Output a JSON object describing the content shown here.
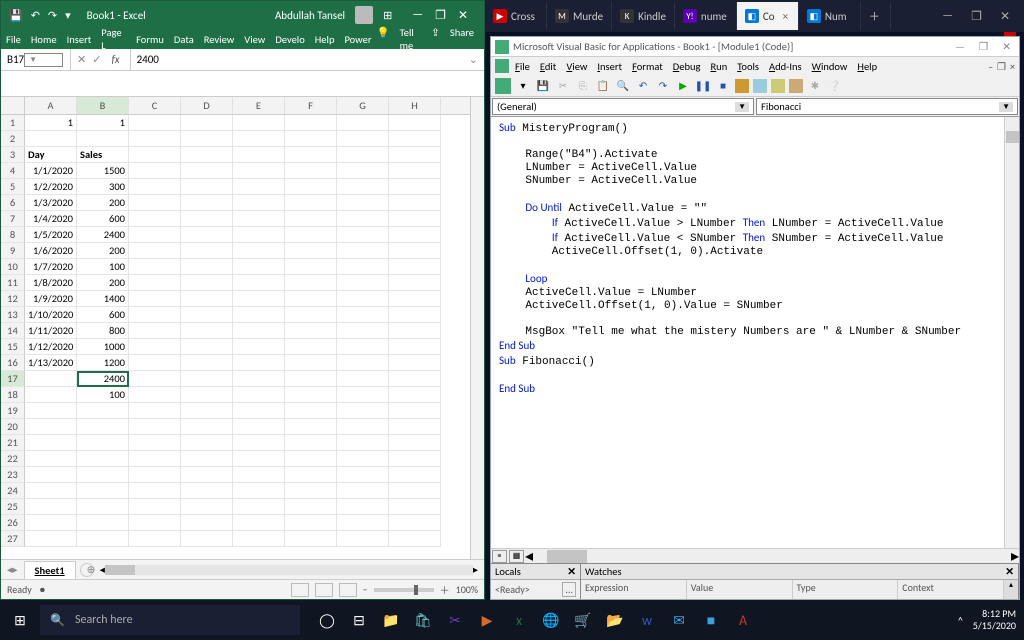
{
  "browser": {
    "tabs": [
      {
        "fav": "▶",
        "favbg": "#c00",
        "label": "Cross"
      },
      {
        "fav": "M",
        "favbg": "#333",
        "label": "Murde"
      },
      {
        "fav": "K",
        "favbg": "#333",
        "label": "Kindle"
      },
      {
        "fav": "Y!",
        "favbg": "#5a00b0",
        "label": "nume"
      },
      {
        "fav": "◧",
        "favbg": "#0078d4",
        "label": "Co",
        "active": true,
        "close": "×"
      },
      {
        "fav": "◧",
        "favbg": "#0078d4",
        "label": "Num"
      }
    ],
    "newtab": "＋",
    "win": {
      "min": "—",
      "max": "❐",
      "close": "✕"
    }
  },
  "excel": {
    "qat": {
      "save": "💾",
      "undo": "↶",
      "redo": "↷",
      "more": "▾"
    },
    "title": "Book1 - Excel",
    "user": "Abdullah Tansel",
    "mode": "⊞",
    "win": {
      "min": "—",
      "max": "❐",
      "close": "✕"
    },
    "ribbon": [
      "File",
      "Home",
      "Insert",
      "Page L",
      "Formu",
      "Data",
      "Review",
      "View",
      "Develo",
      "Help",
      "Power"
    ],
    "tellme_icon": "💡",
    "tellme": "Tell me",
    "share_icon": "⇪",
    "share": "Share",
    "namebox": "B17",
    "fx_icons": {
      "cancel": "✕",
      "accept": "✓",
      "fx": "fx"
    },
    "formula": "2400",
    "cols": [
      "A",
      "B",
      "C",
      "D",
      "E",
      "F",
      "G",
      "H"
    ],
    "rowcount": 27,
    "activeCell": {
      "r": 17,
      "c": 1
    },
    "cells": {
      "1": {
        "A": {
          "v": "1",
          "r": true
        },
        "B": {
          "v": "1",
          "r": true
        }
      },
      "3": {
        "A": {
          "v": "Day",
          "b": true
        },
        "B": {
          "v": "Sales",
          "b": true
        }
      },
      "4": {
        "A": {
          "v": "1/1/2020",
          "r": true
        },
        "B": {
          "v": "1500",
          "r": true
        }
      },
      "5": {
        "A": {
          "v": "1/2/2020",
          "r": true
        },
        "B": {
          "v": "300",
          "r": true
        }
      },
      "6": {
        "A": {
          "v": "1/3/2020",
          "r": true
        },
        "B": {
          "v": "200",
          "r": true
        }
      },
      "7": {
        "A": {
          "v": "1/4/2020",
          "r": true
        },
        "B": {
          "v": "600",
          "r": true
        }
      },
      "8": {
        "A": {
          "v": "1/5/2020",
          "r": true
        },
        "B": {
          "v": "2400",
          "r": true
        }
      },
      "9": {
        "A": {
          "v": "1/6/2020",
          "r": true
        },
        "B": {
          "v": "200",
          "r": true
        }
      },
      "10": {
        "A": {
          "v": "1/7/2020",
          "r": true
        },
        "B": {
          "v": "100",
          "r": true
        }
      },
      "11": {
        "A": {
          "v": "1/8/2020",
          "r": true
        },
        "B": {
          "v": "200",
          "r": true
        }
      },
      "12": {
        "A": {
          "v": "1/9/2020",
          "r": true
        },
        "B": {
          "v": "1400",
          "r": true
        }
      },
      "13": {
        "A": {
          "v": "1/10/2020",
          "r": true
        },
        "B": {
          "v": "600",
          "r": true
        }
      },
      "14": {
        "A": {
          "v": "1/11/2020",
          "r": true
        },
        "B": {
          "v": "800",
          "r": true
        }
      },
      "15": {
        "A": {
          "v": "1/12/2020",
          "r": true
        },
        "B": {
          "v": "1000",
          "r": true
        }
      },
      "16": {
        "A": {
          "v": "1/13/2020",
          "r": true
        },
        "B": {
          "v": "1200",
          "r": true
        }
      },
      "17": {
        "B": {
          "v": "2400",
          "r": true
        }
      },
      "18": {
        "B": {
          "v": "100",
          "r": true
        }
      }
    },
    "sheet": "Sheet1",
    "sheetadd": "⊕",
    "status": "Ready",
    "rec": "⏺",
    "zoom": "100%",
    "zoom_minus": "−",
    "zoom_plus": "＋"
  },
  "vba": {
    "title": "Microsoft Visual Basic for Applications - Book1 - [Module1 (Code)]",
    "win": {
      "min": "—",
      "max": "❐",
      "close": "✕"
    },
    "menu": [
      [
        "F",
        "ile"
      ],
      [
        "E",
        "dit"
      ],
      [
        "V",
        "iew"
      ],
      [
        "I",
        "nsert"
      ],
      [
        "F",
        "o",
        "rmat"
      ],
      [
        "D",
        "ebug"
      ],
      [
        "R",
        "un"
      ],
      [
        "T",
        "ools"
      ],
      [
        "A",
        "dd-Ins"
      ],
      [
        "W",
        "indow"
      ],
      [
        "H",
        "elp"
      ]
    ],
    "mdi": {
      "min": "–",
      "restore": "❐",
      "close": "×"
    },
    "dd1": "(General)",
    "dd2": "Fibonacci",
    "code_lines": [
      [
        [
          "kw",
          "Sub"
        ],
        [
          "",
          " MisteryProgram()"
        ]
      ],
      [
        [
          "",
          "    "
        ]
      ],
      [
        [
          "",
          "    Range(\"B4\").Activate"
        ]
      ],
      [
        [
          "",
          "    LNumber = ActiveCell.Value"
        ]
      ],
      [
        [
          "",
          "    SNumber = ActiveCell.Value"
        ]
      ],
      [
        [
          "",
          "    "
        ]
      ],
      [
        [
          "",
          "    "
        ],
        [
          "kw",
          "Do Until"
        ],
        [
          "",
          " ActiveCell.Value = \"\""
        ]
      ],
      [
        [
          "",
          "        "
        ],
        [
          "kw",
          "If"
        ],
        [
          "",
          " ActiveCell.Value > LNumber "
        ],
        [
          "kw",
          "Then"
        ],
        [
          "",
          " LNumber = ActiveCell.Value"
        ]
      ],
      [
        [
          "",
          "        "
        ],
        [
          "kw",
          "If"
        ],
        [
          "",
          " ActiveCell.Value < SNumber "
        ],
        [
          "kw",
          "Then"
        ],
        [
          "",
          " SNumber = ActiveCell.Value"
        ]
      ],
      [
        [
          "",
          "        ActiveCell.Offset(1, 0).Activate"
        ]
      ],
      [
        [
          "",
          "    "
        ]
      ],
      [
        [
          "",
          "    "
        ],
        [
          "kw",
          "Loop"
        ]
      ],
      [
        [
          "",
          "    ActiveCell.Value = LNumber"
        ]
      ],
      [
        [
          "",
          "    ActiveCell.Offset(1, 0).Value = SNumber"
        ]
      ],
      [
        [
          "",
          "    "
        ]
      ],
      [
        [
          "",
          "    MsgBox \"Tell me what the mistery Numbers are \" & LNumber & SNumber"
        ]
      ],
      [
        [
          "kw",
          "End Sub"
        ]
      ],
      [
        [
          "kw",
          "Sub"
        ],
        [
          "",
          " Fibonacci()"
        ]
      ],
      [
        [
          "",
          "    "
        ]
      ],
      [
        [
          "kw",
          "End Sub"
        ]
      ]
    ],
    "locals": {
      "title": "Locals",
      "ready": "<Ready>",
      "dots": "..."
    },
    "watches": {
      "title": "Watches",
      "cols": [
        "Expression",
        "Value",
        "Type",
        "Context"
      ]
    }
  },
  "taskbar": {
    "start": "⊞",
    "search_icon": "🔍",
    "search": "Search here",
    "icons": [
      "◯",
      "⊟",
      "📁",
      "🛍",
      "✂",
      "▶",
      "x",
      "🌐",
      "🛒",
      "📂",
      "w",
      "✉",
      "■",
      "A"
    ],
    "icon_colors": [
      "#fff",
      "#fff",
      "#e8b54a",
      "#6cc",
      "#6a3fc4",
      "#d66a2a",
      "#1e6f46",
      "#3aa0e0",
      "#2a7",
      "#e8b54a",
      "#2a5cc4",
      "#3aa0e0",
      "#3aa0e0",
      "#c0392b"
    ],
    "tray": "^",
    "time": "8:12 PM",
    "date": "5/15/2020"
  }
}
